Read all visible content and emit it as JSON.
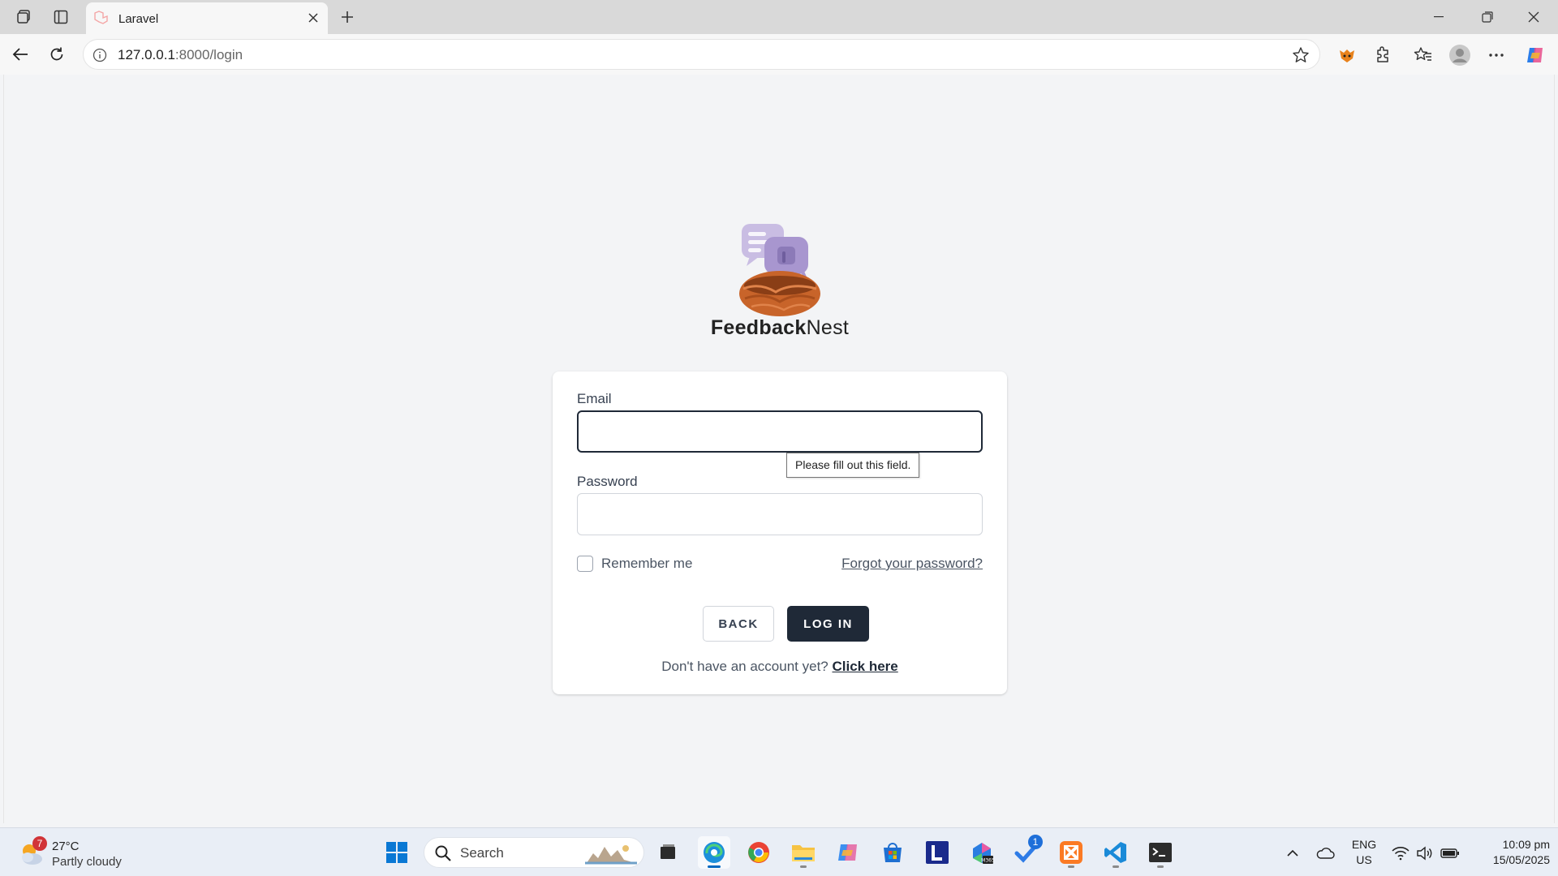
{
  "browser": {
    "tab_title": "Laravel",
    "url_host": "127.0.0.1",
    "url_rest": ":8000/login"
  },
  "page": {
    "brand_bold": "Feedback",
    "brand_regular": "Nest",
    "email_label": "Email",
    "email_value": "",
    "password_label": "Password",
    "password_value": "",
    "tooltip": "Please fill out this field.",
    "remember_label": "Remember me",
    "remember_checked": false,
    "forgot_link": "Forgot your password?",
    "back_button": "BACK",
    "login_button": "LOG IN",
    "signup_prompt": "Don't have an account yet?",
    "signup_link": "Click here"
  },
  "taskbar": {
    "weather_badge": "7",
    "weather_temp": "27°C",
    "weather_desc": "Partly cloudy",
    "search_label": "Search",
    "notification_badge": "1",
    "lang_line1": "ENG",
    "lang_line2": "US",
    "time": "10:09 pm",
    "date": "15/05/2025"
  },
  "colors": {
    "primary_button": "#1f2937",
    "page_background": "#f3f4f6",
    "logo_bubbles": "#b7a6d6",
    "logo_nest": "#c8642a"
  }
}
